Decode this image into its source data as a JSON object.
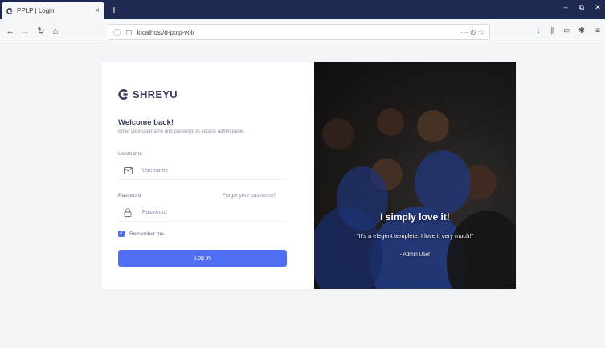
{
  "browser": {
    "tab_title": "PPLP | Login",
    "tab_close": "×",
    "new_tab": "+",
    "url": "localhost/d-pplp-vol/",
    "url_actions": "··· ⊙ ☆",
    "window_controls": {
      "minimize": "–",
      "restore": "⧉",
      "close": "✕"
    }
  },
  "brand": {
    "name": "SHREYU"
  },
  "form": {
    "title": "Welcome back!",
    "subtitle": "Enter your username and password to access admin panel.",
    "username_label": "Username",
    "username_placeholder": "Username",
    "password_label": "Password",
    "password_placeholder": "Password",
    "forgot_link": "Forgot your password?",
    "remember_label": "Remember me",
    "remember_checked": true,
    "submit_label": "Log In"
  },
  "testimonial": {
    "title": "I simply love it!",
    "quote": "\"It's a elegent templete. I love it very much!\"",
    "author": "- Admin User"
  },
  "colors": {
    "accent": "#4f6ef2",
    "tab_bar": "#1f2a52",
    "page_bg": "#f3f5f9",
    "brand_text": "#3b3f5c"
  }
}
